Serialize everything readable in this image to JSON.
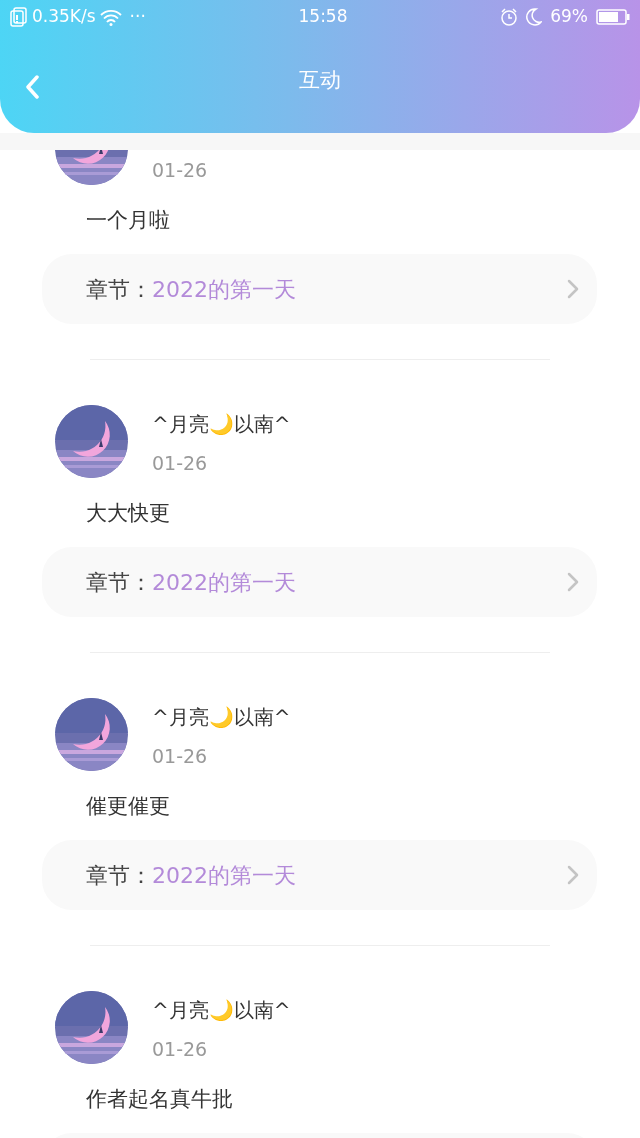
{
  "status_bar": {
    "speed": "0.35K/s",
    "more": "···",
    "time": "15:58",
    "battery": "69%"
  },
  "header": {
    "title": "互动"
  },
  "comments": [
    {
      "date": "01-26",
      "text": "一个月啦",
      "chapter_label": "章节：",
      "chapter": "2022的第一天"
    },
    {
      "name": "^月亮🌙以南^",
      "date": "01-26",
      "text": "大大快更",
      "chapter_label": "章节：",
      "chapter": "2022的第一天"
    },
    {
      "name": "^月亮🌙以南^",
      "date": "01-26",
      "text": "催更催更",
      "chapter_label": "章节：",
      "chapter": "2022的第一天"
    },
    {
      "name": "^月亮🌙以南^",
      "date": "01-26",
      "text": "作者起名真牛批"
    }
  ]
}
